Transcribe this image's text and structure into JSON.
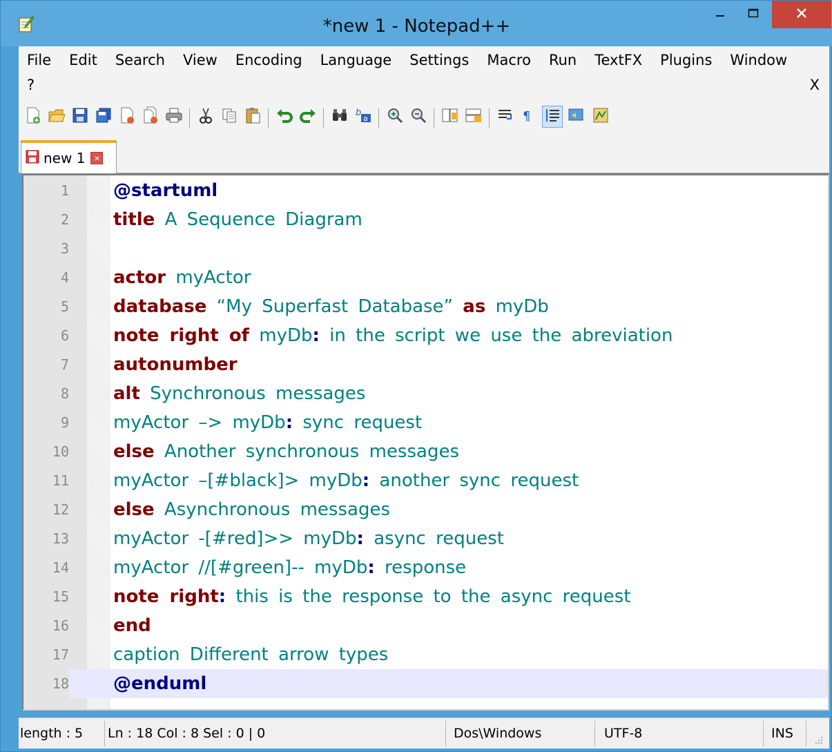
{
  "window": {
    "title": "*new 1 - Notepad++",
    "minimize_icon": "minimize-icon",
    "maximize_icon": "maximize-icon",
    "close_label": "×"
  },
  "menu": {
    "items": [
      "File",
      "Edit",
      "Search",
      "View",
      "Encoding",
      "Language",
      "Settings",
      "Macro",
      "Run",
      "TextFX",
      "Plugins",
      "Window"
    ],
    "help": "?",
    "close_doc": "X"
  },
  "toolbar": {
    "buttons": [
      "new-file-icon",
      "open-file-icon",
      "save-icon",
      "save-all-icon",
      "close-icon",
      "close-all-icon",
      "print-icon",
      "cut-icon",
      "copy-icon",
      "paste-icon",
      "undo-icon",
      "redo-icon",
      "find-icon",
      "replace-icon",
      "zoom-in-icon",
      "zoom-out-icon",
      "sync-vertical-icon",
      "sync-horizontal-icon",
      "word-wrap-icon",
      "show-all-chars-icon",
      "indent-guide-icon",
      "user-defined-language-icon",
      "document-map-icon"
    ]
  },
  "tab": {
    "label": "new 1",
    "close": "×"
  },
  "editor": {
    "lines": [
      {
        "n": "1",
        "segments": [
          {
            "t": "@startuml",
            "c": "at"
          }
        ]
      },
      {
        "n": "2",
        "segments": [
          {
            "t": "title",
            "c": "kw"
          },
          {
            "t": " A Sequence Diagram",
            "c": "tx"
          }
        ]
      },
      {
        "n": "3",
        "segments": []
      },
      {
        "n": "4",
        "segments": [
          {
            "t": "actor",
            "c": "kw"
          },
          {
            "t": " myActor",
            "c": "tx"
          }
        ]
      },
      {
        "n": "5",
        "segments": [
          {
            "t": "database",
            "c": "kw"
          },
          {
            "t": " “My Superfast Database” ",
            "c": "tx"
          },
          {
            "t": "as",
            "c": "kw"
          },
          {
            "t": " myDb",
            "c": "tx"
          }
        ]
      },
      {
        "n": "6",
        "segments": [
          {
            "t": "note right of",
            "c": "kw"
          },
          {
            "t": " myDb",
            "c": "tx"
          },
          {
            "t": ":",
            "c": "colon"
          },
          {
            "t": " in the script we use the abreviation",
            "c": "tx"
          }
        ]
      },
      {
        "n": "7",
        "segments": [
          {
            "t": "autonumber",
            "c": "kw"
          }
        ]
      },
      {
        "n": "8",
        "segments": [
          {
            "t": "alt",
            "c": "kw"
          },
          {
            "t": " Synchronous messages",
            "c": "tx"
          }
        ]
      },
      {
        "n": "9",
        "segments": [
          {
            "t": "myActor –> myDb",
            "c": "tx"
          },
          {
            "t": ":",
            "c": "colon"
          },
          {
            "t": " sync request",
            "c": "tx"
          }
        ]
      },
      {
        "n": "10",
        "segments": [
          {
            "t": "else",
            "c": "kw"
          },
          {
            "t": " Another synchronous messages",
            "c": "tx"
          }
        ]
      },
      {
        "n": "11",
        "segments": [
          {
            "t": "myActor –[#black]> myDb",
            "c": "tx"
          },
          {
            "t": ":",
            "c": "colon"
          },
          {
            "t": " another sync request",
            "c": "tx"
          }
        ]
      },
      {
        "n": "12",
        "segments": [
          {
            "t": "else",
            "c": "kw"
          },
          {
            "t": " Asynchronous messages",
            "c": "tx"
          }
        ]
      },
      {
        "n": "13",
        "segments": [
          {
            "t": "myActor -[#red]>> myDb",
            "c": "tx"
          },
          {
            "t": ":",
            "c": "colon"
          },
          {
            "t": " async request",
            "c": "tx"
          }
        ]
      },
      {
        "n": "14",
        "segments": [
          {
            "t": "myActor //[#green]-- myDb",
            "c": "tx"
          },
          {
            "t": ":",
            "c": "colon"
          },
          {
            "t": " response",
            "c": "tx"
          }
        ]
      },
      {
        "n": "15",
        "segments": [
          {
            "t": "note right",
            "c": "kw"
          },
          {
            "t": ":",
            "c": "colon"
          },
          {
            "t": " this is the response to the async request",
            "c": "tx"
          }
        ]
      },
      {
        "n": "16",
        "segments": [
          {
            "t": "end",
            "c": "kw"
          }
        ]
      },
      {
        "n": "17",
        "segments": [
          {
            "t": "caption Different arrow types",
            "c": "tx"
          }
        ]
      },
      {
        "n": "18",
        "segments": [
          {
            "t": "@enduml",
            "c": "at"
          }
        ]
      }
    ],
    "current_line": 18
  },
  "status": {
    "length": "length : 5",
    "position": "Ln : 18    Col : 8    Sel : 0 | 0",
    "eol": "Dos\\Windows",
    "encoding": "UTF-8",
    "mode": "INS"
  },
  "colors": {
    "keyword": "#800000",
    "text": "#008080",
    "directive": "#000080",
    "current_line": "#e8e8ff",
    "tab_accent": "#f5a623",
    "close_button": "#c7443a"
  }
}
